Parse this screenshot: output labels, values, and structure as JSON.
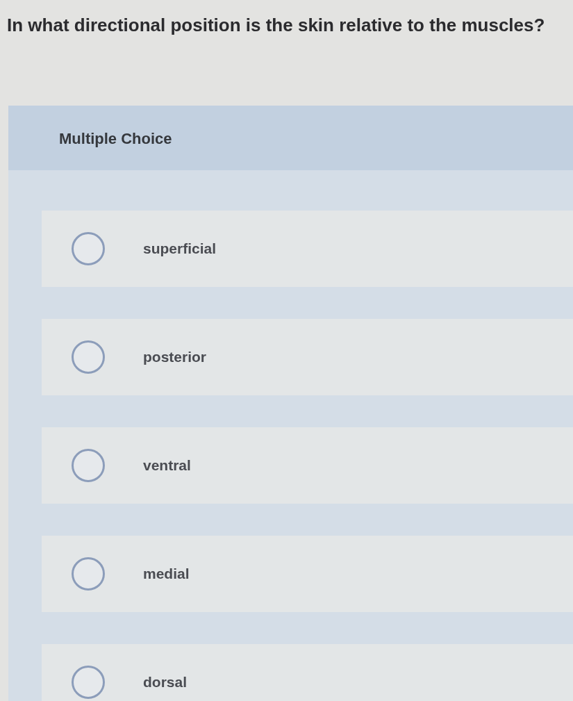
{
  "question": "In what directional position is the skin relative to the muscles?",
  "section": {
    "title": "Multiple Choice"
  },
  "options": [
    {
      "label": "superficial",
      "selected": false
    },
    {
      "label": "posterior",
      "selected": false
    },
    {
      "label": "ventral",
      "selected": false
    },
    {
      "label": "medial",
      "selected": false
    },
    {
      "label": "dorsal",
      "selected": false
    }
  ]
}
